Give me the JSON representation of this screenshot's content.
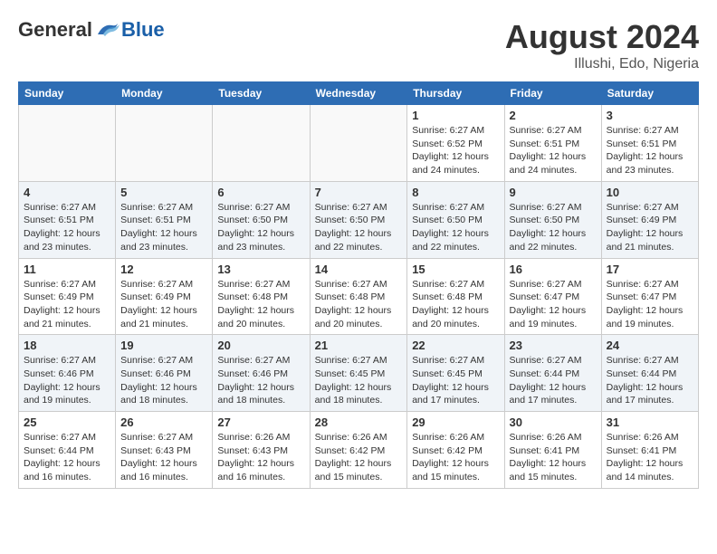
{
  "header": {
    "logo_general": "General",
    "logo_blue": "Blue",
    "month_year": "August 2024",
    "location": "Illushi, Edo, Nigeria"
  },
  "weekdays": [
    "Sunday",
    "Monday",
    "Tuesday",
    "Wednesday",
    "Thursday",
    "Friday",
    "Saturday"
  ],
  "weeks": [
    [
      {
        "day": "",
        "info": ""
      },
      {
        "day": "",
        "info": ""
      },
      {
        "day": "",
        "info": ""
      },
      {
        "day": "",
        "info": ""
      },
      {
        "day": "1",
        "info": "Sunrise: 6:27 AM\nSunset: 6:52 PM\nDaylight: 12 hours\nand 24 minutes."
      },
      {
        "day": "2",
        "info": "Sunrise: 6:27 AM\nSunset: 6:51 PM\nDaylight: 12 hours\nand 24 minutes."
      },
      {
        "day": "3",
        "info": "Sunrise: 6:27 AM\nSunset: 6:51 PM\nDaylight: 12 hours\nand 23 minutes."
      }
    ],
    [
      {
        "day": "4",
        "info": "Sunrise: 6:27 AM\nSunset: 6:51 PM\nDaylight: 12 hours\nand 23 minutes."
      },
      {
        "day": "5",
        "info": "Sunrise: 6:27 AM\nSunset: 6:51 PM\nDaylight: 12 hours\nand 23 minutes."
      },
      {
        "day": "6",
        "info": "Sunrise: 6:27 AM\nSunset: 6:50 PM\nDaylight: 12 hours\nand 23 minutes."
      },
      {
        "day": "7",
        "info": "Sunrise: 6:27 AM\nSunset: 6:50 PM\nDaylight: 12 hours\nand 22 minutes."
      },
      {
        "day": "8",
        "info": "Sunrise: 6:27 AM\nSunset: 6:50 PM\nDaylight: 12 hours\nand 22 minutes."
      },
      {
        "day": "9",
        "info": "Sunrise: 6:27 AM\nSunset: 6:50 PM\nDaylight: 12 hours\nand 22 minutes."
      },
      {
        "day": "10",
        "info": "Sunrise: 6:27 AM\nSunset: 6:49 PM\nDaylight: 12 hours\nand 21 minutes."
      }
    ],
    [
      {
        "day": "11",
        "info": "Sunrise: 6:27 AM\nSunset: 6:49 PM\nDaylight: 12 hours\nand 21 minutes."
      },
      {
        "day": "12",
        "info": "Sunrise: 6:27 AM\nSunset: 6:49 PM\nDaylight: 12 hours\nand 21 minutes."
      },
      {
        "day": "13",
        "info": "Sunrise: 6:27 AM\nSunset: 6:48 PM\nDaylight: 12 hours\nand 20 minutes."
      },
      {
        "day": "14",
        "info": "Sunrise: 6:27 AM\nSunset: 6:48 PM\nDaylight: 12 hours\nand 20 minutes."
      },
      {
        "day": "15",
        "info": "Sunrise: 6:27 AM\nSunset: 6:48 PM\nDaylight: 12 hours\nand 20 minutes."
      },
      {
        "day": "16",
        "info": "Sunrise: 6:27 AM\nSunset: 6:47 PM\nDaylight: 12 hours\nand 19 minutes."
      },
      {
        "day": "17",
        "info": "Sunrise: 6:27 AM\nSunset: 6:47 PM\nDaylight: 12 hours\nand 19 minutes."
      }
    ],
    [
      {
        "day": "18",
        "info": "Sunrise: 6:27 AM\nSunset: 6:46 PM\nDaylight: 12 hours\nand 19 minutes."
      },
      {
        "day": "19",
        "info": "Sunrise: 6:27 AM\nSunset: 6:46 PM\nDaylight: 12 hours\nand 18 minutes."
      },
      {
        "day": "20",
        "info": "Sunrise: 6:27 AM\nSunset: 6:46 PM\nDaylight: 12 hours\nand 18 minutes."
      },
      {
        "day": "21",
        "info": "Sunrise: 6:27 AM\nSunset: 6:45 PM\nDaylight: 12 hours\nand 18 minutes."
      },
      {
        "day": "22",
        "info": "Sunrise: 6:27 AM\nSunset: 6:45 PM\nDaylight: 12 hours\nand 17 minutes."
      },
      {
        "day": "23",
        "info": "Sunrise: 6:27 AM\nSunset: 6:44 PM\nDaylight: 12 hours\nand 17 minutes."
      },
      {
        "day": "24",
        "info": "Sunrise: 6:27 AM\nSunset: 6:44 PM\nDaylight: 12 hours\nand 17 minutes."
      }
    ],
    [
      {
        "day": "25",
        "info": "Sunrise: 6:27 AM\nSunset: 6:44 PM\nDaylight: 12 hours\nand 16 minutes."
      },
      {
        "day": "26",
        "info": "Sunrise: 6:27 AM\nSunset: 6:43 PM\nDaylight: 12 hours\nand 16 minutes."
      },
      {
        "day": "27",
        "info": "Sunrise: 6:26 AM\nSunset: 6:43 PM\nDaylight: 12 hours\nand 16 minutes."
      },
      {
        "day": "28",
        "info": "Sunrise: 6:26 AM\nSunset: 6:42 PM\nDaylight: 12 hours\nand 15 minutes."
      },
      {
        "day": "29",
        "info": "Sunrise: 6:26 AM\nSunset: 6:42 PM\nDaylight: 12 hours\nand 15 minutes."
      },
      {
        "day": "30",
        "info": "Sunrise: 6:26 AM\nSunset: 6:41 PM\nDaylight: 12 hours\nand 15 minutes."
      },
      {
        "day": "31",
        "info": "Sunrise: 6:26 AM\nSunset: 6:41 PM\nDaylight: 12 hours\nand 14 minutes."
      }
    ]
  ]
}
